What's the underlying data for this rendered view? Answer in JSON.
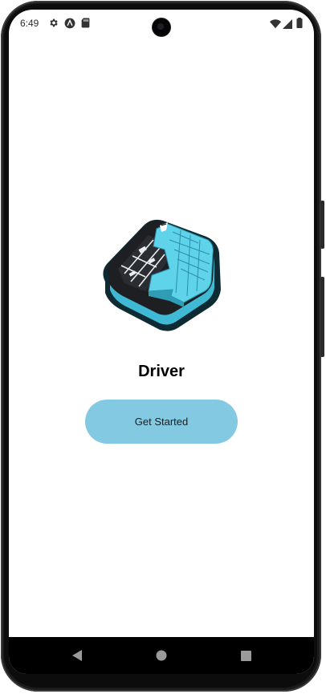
{
  "status_bar": {
    "time": "6:49",
    "left_icons": [
      "settings-icon",
      "a-badge-icon",
      "sd-card-icon"
    ],
    "right_icons": [
      "wifi-icon",
      "signal-icon",
      "battery-icon"
    ]
  },
  "app": {
    "title": "Driver",
    "logo": "map-tile-icon",
    "accent_color": "#84c9e2"
  },
  "actions": {
    "get_started_label": "Get Started"
  },
  "nav_bar": {
    "buttons": [
      "back-icon",
      "home-icon",
      "recents-icon"
    ]
  }
}
